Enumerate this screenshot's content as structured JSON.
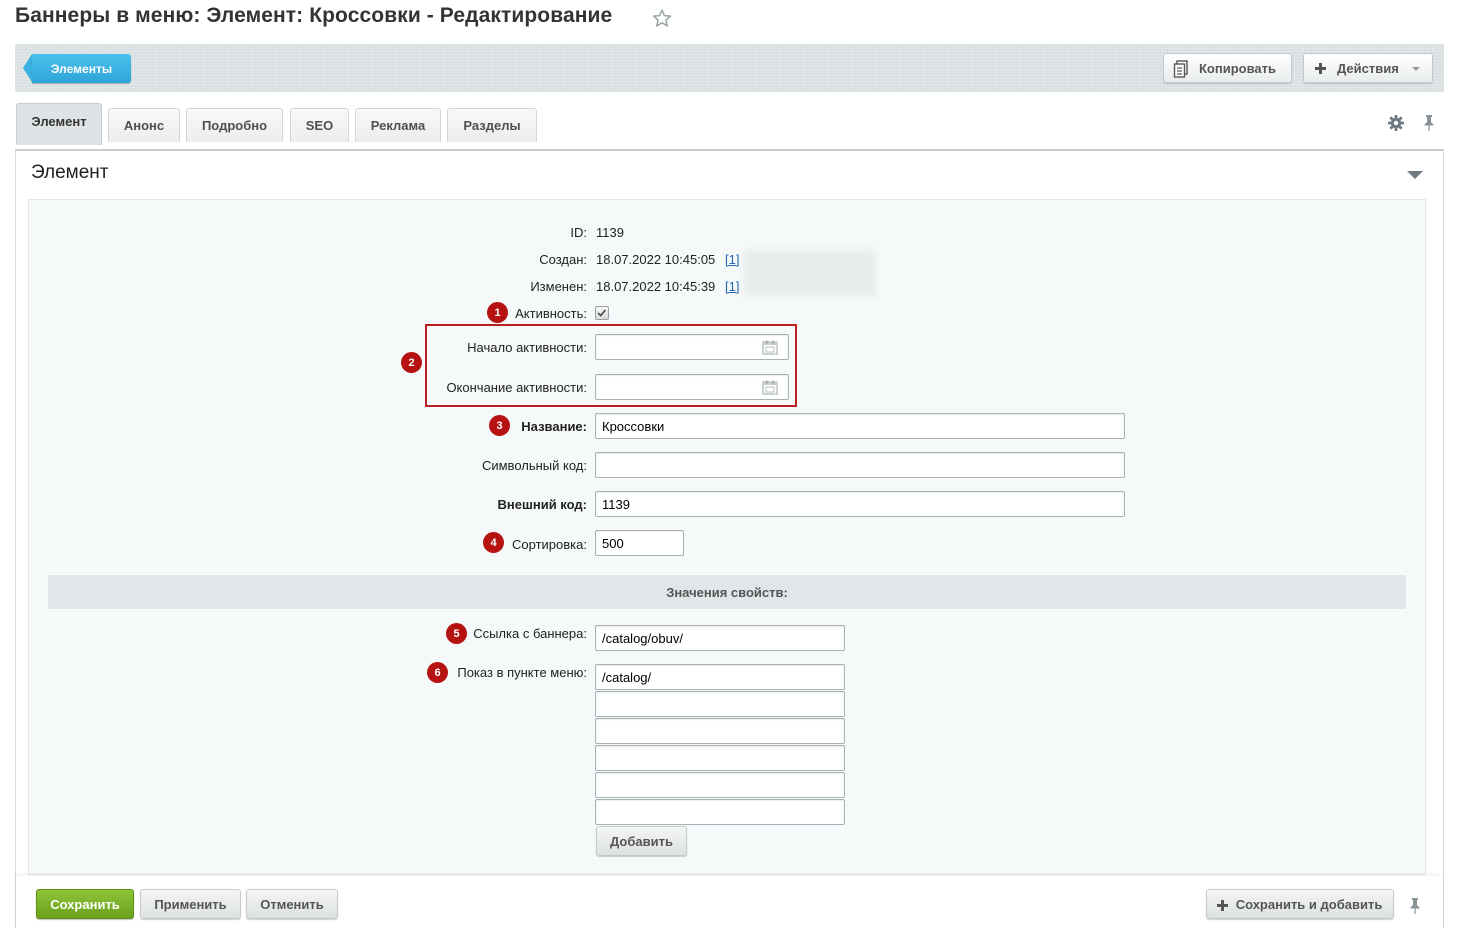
{
  "page": {
    "title": "Баннеры в меню: Элемент: Кроссовки - Редактирование"
  },
  "toolbar": {
    "elements_button": "Элементы",
    "copy_button": "Копировать",
    "actions_button": "Действия"
  },
  "tabs": [
    {
      "label": "Элемент",
      "active": true
    },
    {
      "label": "Анонс"
    },
    {
      "label": "Подробно"
    },
    {
      "label": "SEO"
    },
    {
      "label": "Реклама"
    },
    {
      "label": "Разделы"
    }
  ],
  "section": {
    "title": "Элемент"
  },
  "form": {
    "id_label": "ID:",
    "id_value": "1139",
    "created_label": "Создан:",
    "created_value": "18.07.2022 10:45:05",
    "created_user_link": "[1]",
    "modified_label": "Изменен:",
    "modified_value": "18.07.2022 10:45:39",
    "modified_user_link": "[1]",
    "active_label": "Активность:",
    "active_checked": true,
    "active_from_label": "Начало активности:",
    "active_from_value": "",
    "active_to_label": "Окончание активности:",
    "active_to_value": "",
    "name_label": "Название:",
    "name_value": "Кроссовки",
    "code_label": "Символьный код:",
    "code_value": "",
    "xml_id_label": "Внешний код:",
    "xml_id_value": "1139",
    "sort_label": "Сортировка:",
    "sort_value": "500"
  },
  "properties": {
    "header": "Значения свойств:",
    "link_label": "Ссылка с баннера:",
    "link_value": "/catalog/obuv/",
    "menu_label": "Показ в пункте меню:",
    "menu_values": [
      "/catalog/",
      "",
      "",
      "",
      "",
      ""
    ],
    "add_button": "Добавить"
  },
  "markers": [
    "1",
    "2",
    "3",
    "4",
    "5",
    "6"
  ],
  "footer": {
    "save_button": "Сохранить",
    "apply_button": "Применить",
    "cancel_button": "Отменить",
    "save_add_button": "Сохранить и добавить"
  },
  "colors": {
    "accent_blue": "#2fa4d8",
    "save_green": "#6ba11b",
    "marker_red": "#b71212",
    "link_blue": "#2067b0"
  },
  "icons": [
    "star-icon",
    "copy-icon",
    "plus-icon",
    "chevron-down-icon",
    "gear-icon",
    "pin-icon",
    "calendar-icon",
    "collapse-arrow-icon",
    "checkmark-icon"
  ]
}
